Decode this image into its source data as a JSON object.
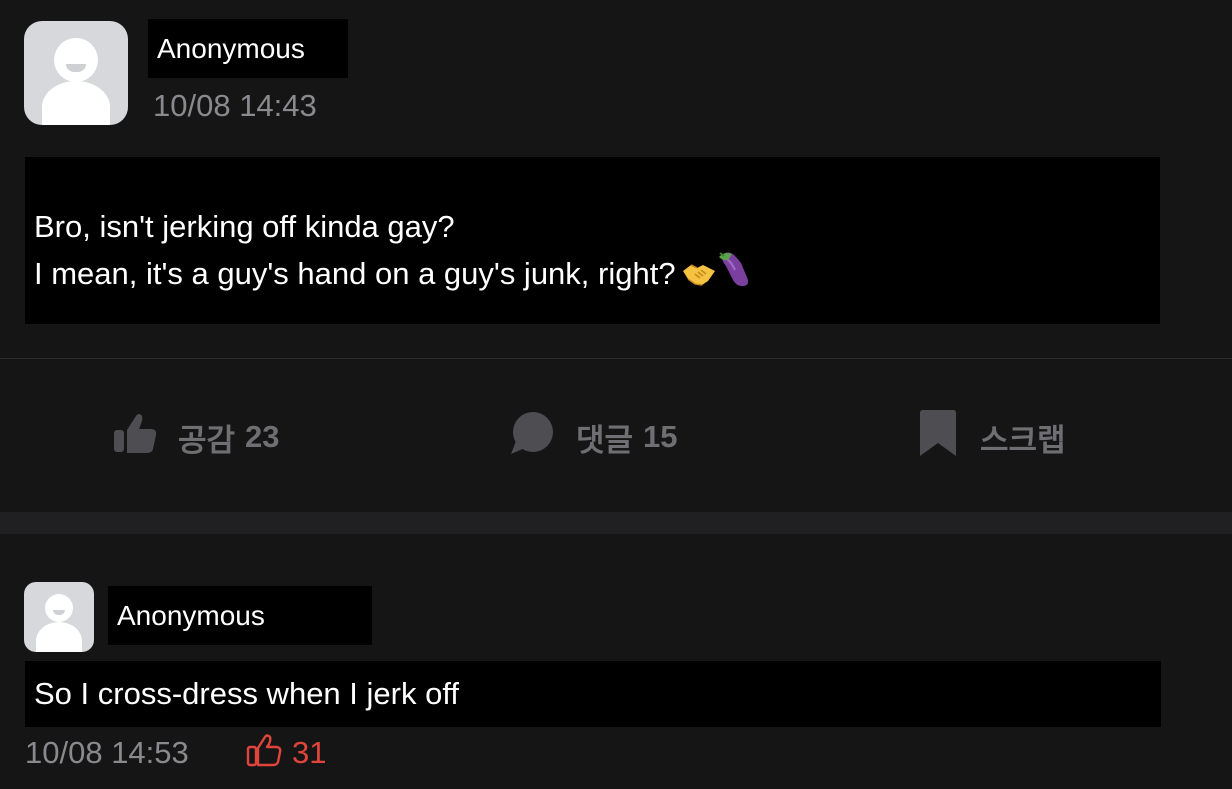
{
  "post": {
    "author": "Anonymous",
    "timestamp": "10/08 14:43",
    "lines": [
      "Bro, isn't jerking off kinda gay?",
      "I mean, it's a guy's hand on a guy's junk, right?"
    ],
    "emojis": [
      "handshake-emoji",
      "eggplant-emoji"
    ],
    "actions": {
      "like": {
        "label": "공감",
        "count": "23",
        "icon": "thumbs-up-icon"
      },
      "comment": {
        "label": "댓글",
        "count": "15",
        "icon": "comment-bubble-icon"
      },
      "scrap": {
        "label": "스크랩",
        "icon": "bookmark-icon"
      }
    }
  },
  "comment": {
    "author": "Anonymous",
    "text": "So I cross-dress when I jerk off",
    "timestamp": "10/08 14:53",
    "likes": "31",
    "like_icon": "thumbs-up-outline-icon"
  },
  "colors": {
    "background": "#151515",
    "muted": "#6e6e73",
    "timestamp": "#8a8a8e",
    "like_accent": "#e0453b",
    "redaction": "#000000"
  }
}
